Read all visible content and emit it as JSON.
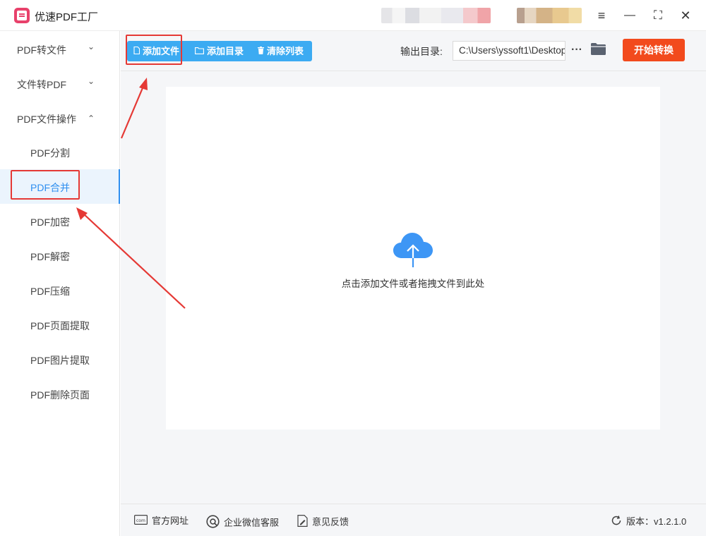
{
  "app": {
    "title": "优速PDF工厂",
    "logo_text": "PDF"
  },
  "window_controls": {
    "menu": "≡",
    "minimize": "—",
    "maximize": "⛶",
    "close": "✕"
  },
  "sidebar": {
    "groups": [
      {
        "label": "PDF转文件",
        "chevron": "⌄"
      },
      {
        "label": "文件转PDF",
        "chevron": "⌄"
      },
      {
        "label": "PDF文件操作",
        "chevron": "⌃"
      }
    ],
    "sub_items": [
      {
        "label": "PDF分割"
      },
      {
        "label": "PDF合并",
        "active": true
      },
      {
        "label": "PDF加密"
      },
      {
        "label": "PDF解密"
      },
      {
        "label": "PDF压缩"
      },
      {
        "label": "PDF页面提取"
      },
      {
        "label": "PDF图片提取"
      },
      {
        "label": "PDF删除页面"
      }
    ]
  },
  "toolbar": {
    "add_file": "添加文件",
    "add_folder": "添加目录",
    "clear_list": "清除列表",
    "output_label": "输出目录:",
    "output_path": "C:\\Users\\yssoft1\\Desktop",
    "more": "···",
    "start": "开始转换"
  },
  "drop_zone": {
    "hint": "点击添加文件或者拖拽文件到此处"
  },
  "footer": {
    "website": "官方网址",
    "wechat": "企业微信客服",
    "feedback": "意见反馈",
    "version": "版本：v1.2.1.0"
  },
  "colors": {
    "accent": "#3cabf2",
    "active": "#2f8ff0",
    "start_button": "#f24a1d",
    "annotation": "#e53935"
  }
}
